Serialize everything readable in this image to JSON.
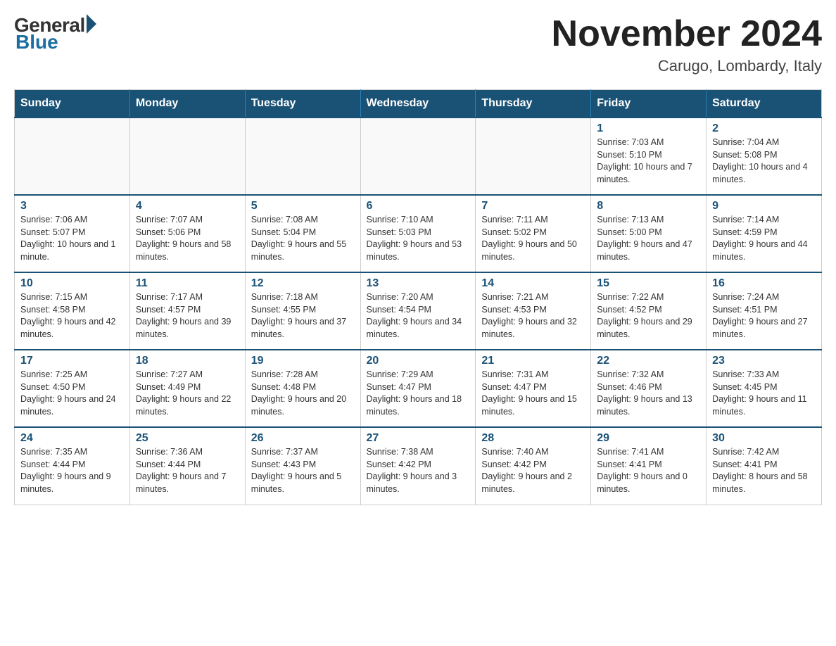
{
  "logo": {
    "general": "General",
    "blue": "Blue"
  },
  "title": {
    "month": "November 2024",
    "location": "Carugo, Lombardy, Italy"
  },
  "weekdays": [
    "Sunday",
    "Monday",
    "Tuesday",
    "Wednesday",
    "Thursday",
    "Friday",
    "Saturday"
  ],
  "weeks": [
    [
      {
        "day": "",
        "info": ""
      },
      {
        "day": "",
        "info": ""
      },
      {
        "day": "",
        "info": ""
      },
      {
        "day": "",
        "info": ""
      },
      {
        "day": "",
        "info": ""
      },
      {
        "day": "1",
        "info": "Sunrise: 7:03 AM\nSunset: 5:10 PM\nDaylight: 10 hours and 7 minutes."
      },
      {
        "day": "2",
        "info": "Sunrise: 7:04 AM\nSunset: 5:08 PM\nDaylight: 10 hours and 4 minutes."
      }
    ],
    [
      {
        "day": "3",
        "info": "Sunrise: 7:06 AM\nSunset: 5:07 PM\nDaylight: 10 hours and 1 minute."
      },
      {
        "day": "4",
        "info": "Sunrise: 7:07 AM\nSunset: 5:06 PM\nDaylight: 9 hours and 58 minutes."
      },
      {
        "day": "5",
        "info": "Sunrise: 7:08 AM\nSunset: 5:04 PM\nDaylight: 9 hours and 55 minutes."
      },
      {
        "day": "6",
        "info": "Sunrise: 7:10 AM\nSunset: 5:03 PM\nDaylight: 9 hours and 53 minutes."
      },
      {
        "day": "7",
        "info": "Sunrise: 7:11 AM\nSunset: 5:02 PM\nDaylight: 9 hours and 50 minutes."
      },
      {
        "day": "8",
        "info": "Sunrise: 7:13 AM\nSunset: 5:00 PM\nDaylight: 9 hours and 47 minutes."
      },
      {
        "day": "9",
        "info": "Sunrise: 7:14 AM\nSunset: 4:59 PM\nDaylight: 9 hours and 44 minutes."
      }
    ],
    [
      {
        "day": "10",
        "info": "Sunrise: 7:15 AM\nSunset: 4:58 PM\nDaylight: 9 hours and 42 minutes."
      },
      {
        "day": "11",
        "info": "Sunrise: 7:17 AM\nSunset: 4:57 PM\nDaylight: 9 hours and 39 minutes."
      },
      {
        "day": "12",
        "info": "Sunrise: 7:18 AM\nSunset: 4:55 PM\nDaylight: 9 hours and 37 minutes."
      },
      {
        "day": "13",
        "info": "Sunrise: 7:20 AM\nSunset: 4:54 PM\nDaylight: 9 hours and 34 minutes."
      },
      {
        "day": "14",
        "info": "Sunrise: 7:21 AM\nSunset: 4:53 PM\nDaylight: 9 hours and 32 minutes."
      },
      {
        "day": "15",
        "info": "Sunrise: 7:22 AM\nSunset: 4:52 PM\nDaylight: 9 hours and 29 minutes."
      },
      {
        "day": "16",
        "info": "Sunrise: 7:24 AM\nSunset: 4:51 PM\nDaylight: 9 hours and 27 minutes."
      }
    ],
    [
      {
        "day": "17",
        "info": "Sunrise: 7:25 AM\nSunset: 4:50 PM\nDaylight: 9 hours and 24 minutes."
      },
      {
        "day": "18",
        "info": "Sunrise: 7:27 AM\nSunset: 4:49 PM\nDaylight: 9 hours and 22 minutes."
      },
      {
        "day": "19",
        "info": "Sunrise: 7:28 AM\nSunset: 4:48 PM\nDaylight: 9 hours and 20 minutes."
      },
      {
        "day": "20",
        "info": "Sunrise: 7:29 AM\nSunset: 4:47 PM\nDaylight: 9 hours and 18 minutes."
      },
      {
        "day": "21",
        "info": "Sunrise: 7:31 AM\nSunset: 4:47 PM\nDaylight: 9 hours and 15 minutes."
      },
      {
        "day": "22",
        "info": "Sunrise: 7:32 AM\nSunset: 4:46 PM\nDaylight: 9 hours and 13 minutes."
      },
      {
        "day": "23",
        "info": "Sunrise: 7:33 AM\nSunset: 4:45 PM\nDaylight: 9 hours and 11 minutes."
      }
    ],
    [
      {
        "day": "24",
        "info": "Sunrise: 7:35 AM\nSunset: 4:44 PM\nDaylight: 9 hours and 9 minutes."
      },
      {
        "day": "25",
        "info": "Sunrise: 7:36 AM\nSunset: 4:44 PM\nDaylight: 9 hours and 7 minutes."
      },
      {
        "day": "26",
        "info": "Sunrise: 7:37 AM\nSunset: 4:43 PM\nDaylight: 9 hours and 5 minutes."
      },
      {
        "day": "27",
        "info": "Sunrise: 7:38 AM\nSunset: 4:42 PM\nDaylight: 9 hours and 3 minutes."
      },
      {
        "day": "28",
        "info": "Sunrise: 7:40 AM\nSunset: 4:42 PM\nDaylight: 9 hours and 2 minutes."
      },
      {
        "day": "29",
        "info": "Sunrise: 7:41 AM\nSunset: 4:41 PM\nDaylight: 9 hours and 0 minutes."
      },
      {
        "day": "30",
        "info": "Sunrise: 7:42 AM\nSunset: 4:41 PM\nDaylight: 8 hours and 58 minutes."
      }
    ]
  ]
}
